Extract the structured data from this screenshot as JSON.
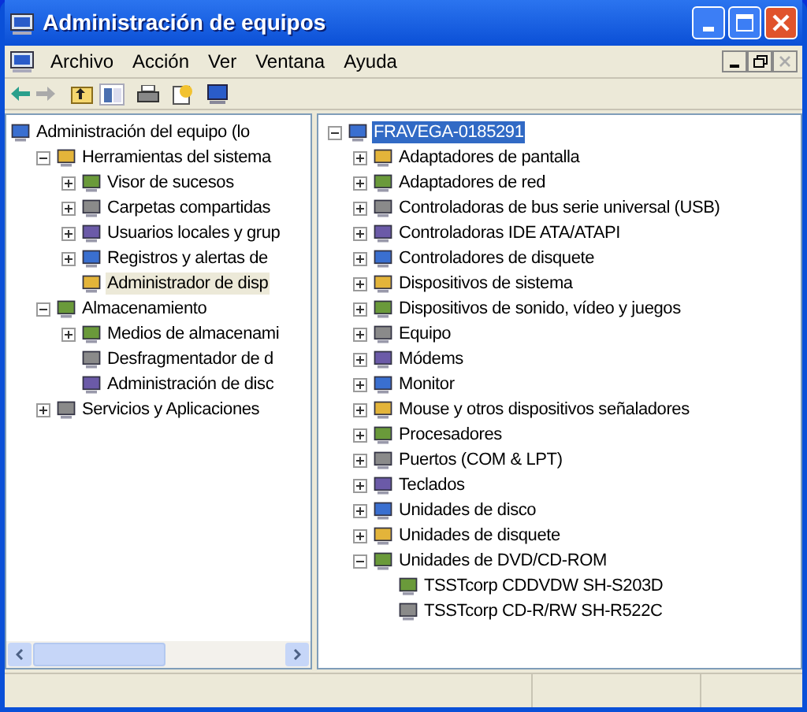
{
  "window": {
    "title": "Administración de equipos"
  },
  "menu": [
    "Archivo",
    "Acción",
    "Ver",
    "Ventana",
    "Ayuda"
  ],
  "left_tree": [
    {
      "label": "Administración del equipo (lo",
      "selected": false,
      "children": [
        {
          "label": "Herramientas del sistema",
          "expanded": true,
          "selected": false,
          "children": [
            {
              "label": "Visor de sucesos",
              "expanded": false,
              "selected": false
            },
            {
              "label": "Carpetas compartidas",
              "expanded": false,
              "selected": false
            },
            {
              "label": "Usuarios locales y grup",
              "expanded": false,
              "selected": false
            },
            {
              "label": "Registros y alertas de",
              "expanded": false,
              "selected": false
            },
            {
              "label": "Administrador de disp",
              "selected": true
            }
          ]
        },
        {
          "label": "Almacenamiento",
          "expanded": true,
          "selected": false,
          "children": [
            {
              "label": "Medios de almacenami",
              "expanded": false,
              "selected": false
            },
            {
              "label": "Desfragmentador de d",
              "selected": false
            },
            {
              "label": "Administración de disc",
              "selected": false
            }
          ]
        },
        {
          "label": "Servicios y Aplicaciones",
          "expanded": false,
          "selected": false
        }
      ]
    }
  ],
  "right_tree": [
    {
      "label": "FRAVEGA-0185291",
      "expanded": true,
      "selected": true,
      "children": [
        {
          "label": "Adaptadores de pantalla",
          "expanded": false,
          "selected": false
        },
        {
          "label": "Adaptadores de red",
          "expanded": false,
          "selected": false
        },
        {
          "label": "Controladoras de bus serie universal (USB)",
          "expanded": false,
          "selected": false
        },
        {
          "label": "Controladoras IDE ATA/ATAPI",
          "expanded": false,
          "selected": false
        },
        {
          "label": "Controladores de disquete",
          "expanded": false,
          "selected": false
        },
        {
          "label": "Dispositivos de sistema",
          "expanded": false,
          "selected": false
        },
        {
          "label": "Dispositivos de sonido, vídeo y juegos",
          "expanded": false,
          "selected": false
        },
        {
          "label": "Equipo",
          "expanded": false,
          "selected": false
        },
        {
          "label": "Módems",
          "expanded": false,
          "selected": false
        },
        {
          "label": "Monitor",
          "expanded": false,
          "selected": false
        },
        {
          "label": "Mouse y otros dispositivos señaladores",
          "expanded": false,
          "selected": false
        },
        {
          "label": "Procesadores",
          "expanded": false,
          "selected": false
        },
        {
          "label": "Puertos (COM & LPT)",
          "expanded": false,
          "selected": false
        },
        {
          "label": "Teclados",
          "expanded": false,
          "selected": false
        },
        {
          "label": "Unidades de disco",
          "expanded": false,
          "selected": false
        },
        {
          "label": "Unidades de disquete",
          "expanded": false,
          "selected": false
        },
        {
          "label": "Unidades de DVD/CD-ROM",
          "expanded": true,
          "selected": false,
          "children": [
            {
              "label": "TSSTcorp CDDVDW SH-S203D",
              "selected": false
            },
            {
              "label": "TSSTcorp CD-R/RW SH-R522C",
              "selected": false
            }
          ]
        }
      ]
    }
  ]
}
